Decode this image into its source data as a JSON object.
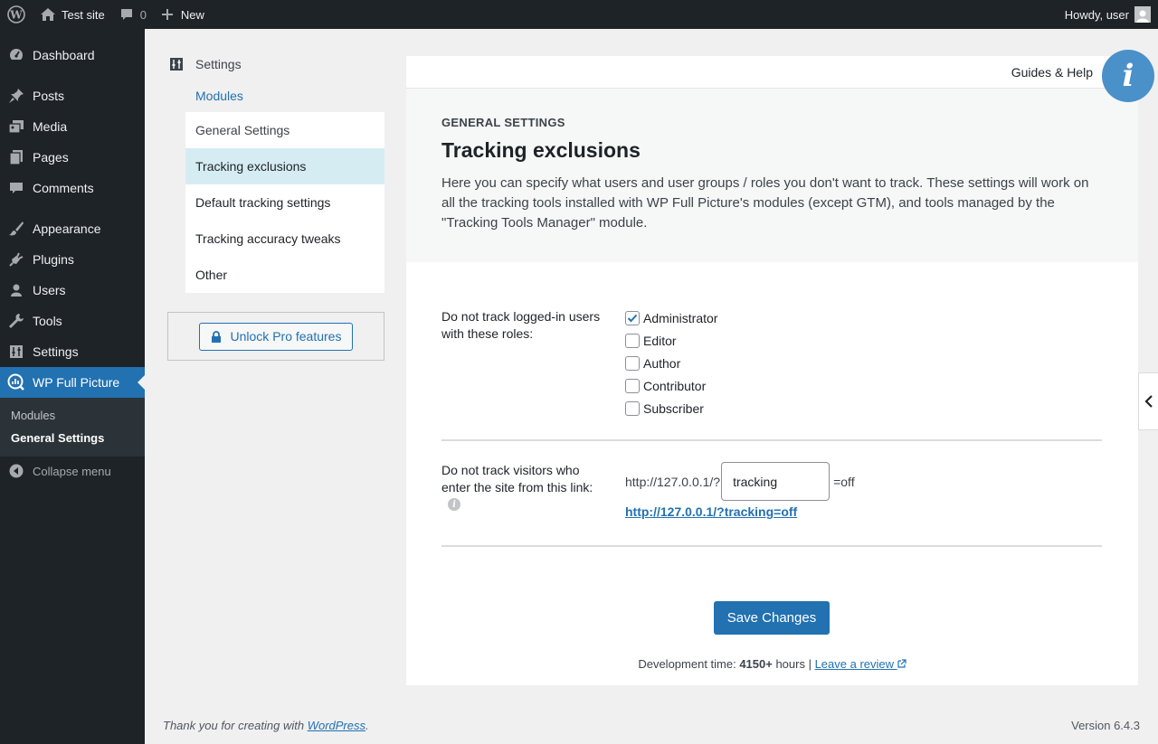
{
  "adminbar": {
    "site_name": "Test site",
    "comments_count": "0",
    "new_label": "New",
    "howdy": "Howdy, user"
  },
  "sidebar": {
    "items": [
      {
        "label": "Dashboard",
        "icon": "dashboard-icon"
      },
      {
        "label": "Posts",
        "icon": "pin-icon"
      },
      {
        "label": "Media",
        "icon": "media-icon"
      },
      {
        "label": "Pages",
        "icon": "pages-icon"
      },
      {
        "label": "Comments",
        "icon": "comment-icon"
      },
      {
        "label": "Appearance",
        "icon": "brush-icon"
      },
      {
        "label": "Plugins",
        "icon": "plug-icon"
      },
      {
        "label": "Users",
        "icon": "user-icon"
      },
      {
        "label": "Tools",
        "icon": "wrench-icon"
      },
      {
        "label": "Settings",
        "icon": "sliders-icon"
      },
      {
        "label": "WP Full Picture",
        "icon": "chart-icon"
      }
    ],
    "submenu": [
      "Modules",
      "General Settings"
    ],
    "collapse": "Collapse menu"
  },
  "plugin_nav": {
    "title": "Settings",
    "modules": "Modules",
    "items": [
      "General Settings",
      "Tracking exclusions",
      "Default tracking settings",
      "Tracking accuracy tweaks",
      "Other"
    ],
    "pro_button": "Unlock Pro features"
  },
  "panel": {
    "guides": "Guides & Help",
    "eyebrow": "GENERAL SETTINGS",
    "title": "Tracking exclusions",
    "description": "Here you can specify what users and user groups / roles you don't want to track. These settings will work on all the tracking tools installed with WP Full Picture's modules (except GTM), and tools managed by the \"Tracking Tools Manager\" module.",
    "roles_label": "Do not track logged-in users with these roles:",
    "roles": [
      {
        "label": "Administrator",
        "checked": true
      },
      {
        "label": "Editor",
        "checked": false
      },
      {
        "label": "Author",
        "checked": false
      },
      {
        "label": "Contributor",
        "checked": false
      },
      {
        "label": "Subscriber",
        "checked": false
      }
    ],
    "link_label": "Do not track visitors who enter the site from this link:",
    "url_prefix": "http://127.0.0.1/?",
    "param_value": "tracking",
    "url_suffix": "=off",
    "full_link": "http://127.0.0.1/?tracking=off",
    "save": "Save Changes",
    "dev_prefix": "Development time: ",
    "dev_hours": "4150+",
    "dev_mid": " hours | ",
    "review": "Leave a review"
  },
  "footer": {
    "thanks_prefix": "Thank you for creating with ",
    "wp_link": "WordPress",
    "thanks_suffix": ".",
    "version": "Version 6.4.3"
  },
  "colors": {
    "accent": "#2271b1",
    "sidebar_bg": "#1d2327",
    "selected_nav": "#d6ecf3",
    "info": "#4a90c9"
  }
}
